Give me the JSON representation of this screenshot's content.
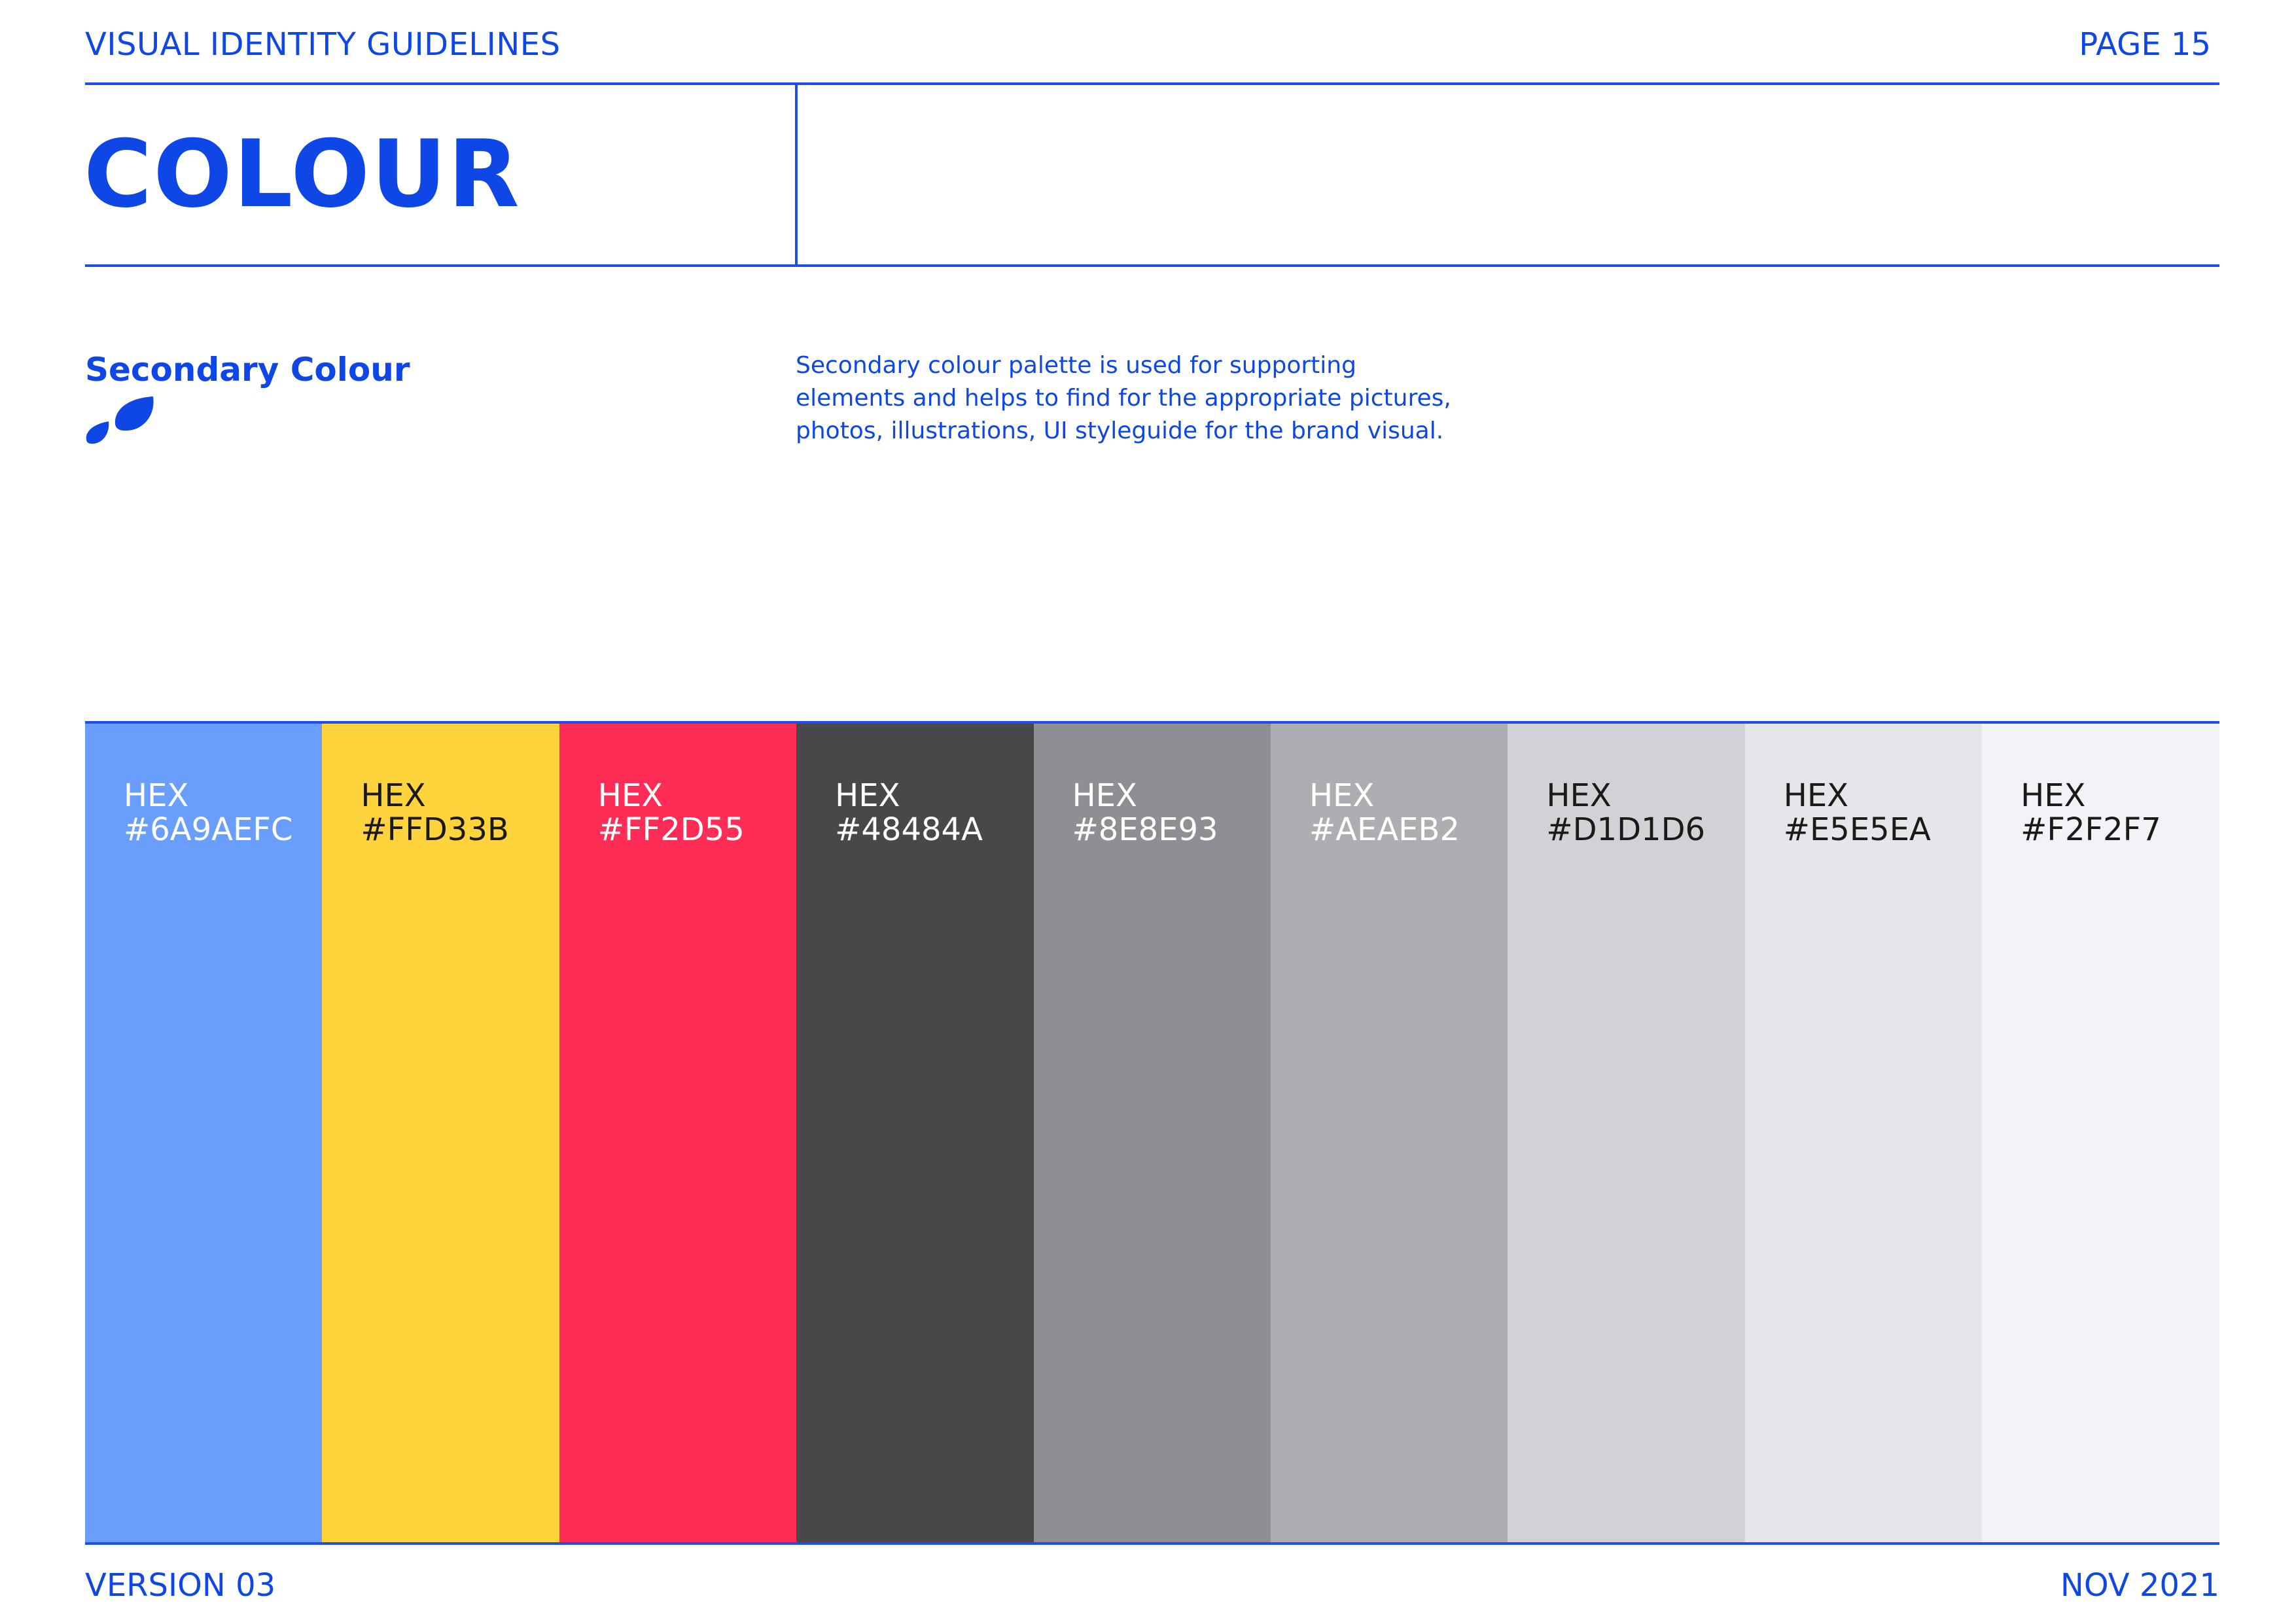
{
  "header": {
    "left": "VISUAL IDENTITY GUIDELINES",
    "right": "PAGE 15"
  },
  "title": "COLOUR",
  "section": {
    "heading": "Secondary Colour",
    "description_lines": [
      "Secondary colour palette is used for supporting",
      "elements and helps to find for the appropriate pictures,",
      "photos, illustrations, UI styleguide for the brand visual."
    ]
  },
  "palette": [
    {
      "label": "HEX",
      "value": "#6A9AEFC",
      "color": "#6A9EFC",
      "text_color": "#FFFFFF"
    },
    {
      "label": "HEX",
      "value": "#FFD33B",
      "color": "#FFD33B",
      "text_color": "#1A1A1A"
    },
    {
      "label": "HEX",
      "value": "#FF2D55",
      "color": "#FF2D55",
      "text_color": "#FFFFFF"
    },
    {
      "label": "HEX",
      "value": "#48484A",
      "color": "#48484A",
      "text_color": "#FFFFFF"
    },
    {
      "label": "HEX",
      "value": "#8E8E93",
      "color": "#8E8E93",
      "text_color": "#FFFFFF"
    },
    {
      "label": "HEX",
      "value": "#AEAEB2",
      "color": "#AEAEB2",
      "text_color": "#FFFFFF"
    },
    {
      "label": "HEX",
      "value": "#D1D1D6",
      "color": "#D1D1D6",
      "text_color": "#1A1A1A"
    },
    {
      "label": "HEX",
      "value": "#E5E5EA",
      "color": "#E5E5EA",
      "text_color": "#1A1A1A"
    },
    {
      "label": "HEX",
      "value": "#F2F2F7",
      "color": "#F2F2F7",
      "text_color": "#1A1A1A"
    }
  ],
  "footer": {
    "left": "VERSION 03",
    "right": "NOV 2021"
  },
  "brand_color": "#0F47E6",
  "icon": "two-drops-icon"
}
